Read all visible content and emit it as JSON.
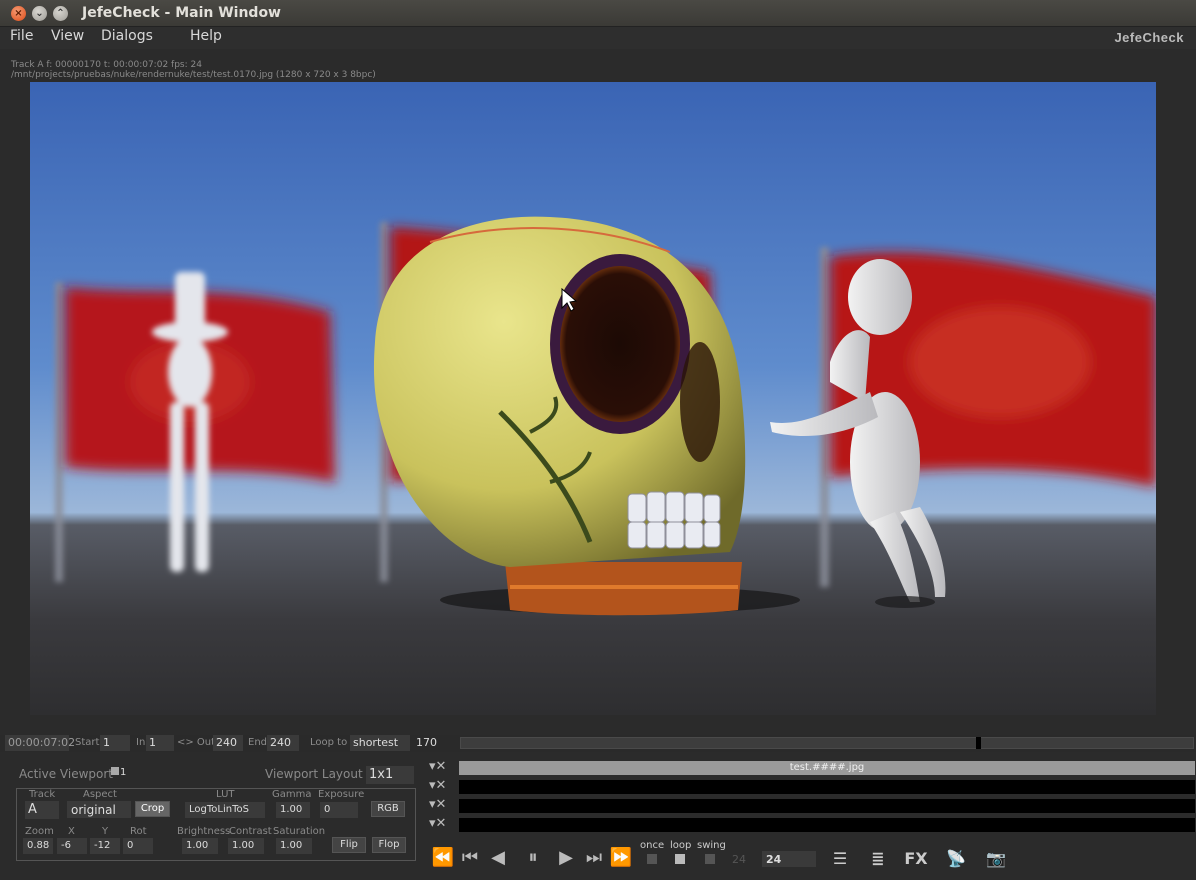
{
  "window": {
    "title": "JefeCheck - Main Window",
    "close_glyph": "×",
    "min_glyph": "⌄",
    "max_glyph": "⌃"
  },
  "menu": {
    "items": [
      "File",
      "View",
      "Dialogs",
      "Help"
    ],
    "logo": "JefeCheck"
  },
  "info": {
    "line1": "Track A   f: 00000170   t: 00:00:07:02   fps: 24",
    "line2": "/mnt/projects/pruebas/nuke/rendernuke/test/test.0170.jpg (1280 x 720 x 3 8bpc)"
  },
  "timeline": {
    "timecode": "00:00:07:02",
    "start_label": "Start",
    "start": "1",
    "in_label": "In",
    "in": "1",
    "out_label": "<> Out",
    "out": "240",
    "end_label": "End",
    "end": "240",
    "loop_label": "Loop to",
    "loop_value": "shortest",
    "frame": "170",
    "playhead_fraction": 0.708
  },
  "viewport": {
    "active_label": "Active Viewport",
    "active_value": "1",
    "layout_label": "Viewport Layout",
    "layout_value": "1x1"
  },
  "controls": {
    "track_label": "Track",
    "track_value": "A",
    "aspect_label": "Aspect",
    "aspect_value": "original",
    "crop_label": "Crop",
    "lut_label": "LUT",
    "lut_value": "LogToLinToS",
    "gamma_label": "Gamma",
    "gamma_value": "1.00",
    "exposure_label": "Exposure",
    "exposure_value": "0",
    "rgb_label": "RGB",
    "zoom_label": "Zoom",
    "zoom_value": "0.88",
    "x_label": "X",
    "x_value": "-6",
    "y_label": "Y",
    "y_value": "-12",
    "rot_label": "Rot",
    "rot_value": "0",
    "brightness_label": "Brightness",
    "brightness_value": "1.00",
    "contrast_label": "Contrast",
    "contrast_value": "1.00",
    "saturation_label": "Saturation",
    "saturation_value": "1.00",
    "flip_label": "Flip",
    "flop_label": "Flop"
  },
  "tracks": {
    "items": [
      "test.####.jpg",
      "",
      "",
      ""
    ]
  },
  "transport": {
    "once_label": "once",
    "loop_label": "loop",
    "swing_label": "swing",
    "fps_dim": "24",
    "fps_value": "24",
    "fx_label": "FX"
  },
  "colors": {
    "accent": "#9a9a9a",
    "background": "#2b2b2b"
  }
}
